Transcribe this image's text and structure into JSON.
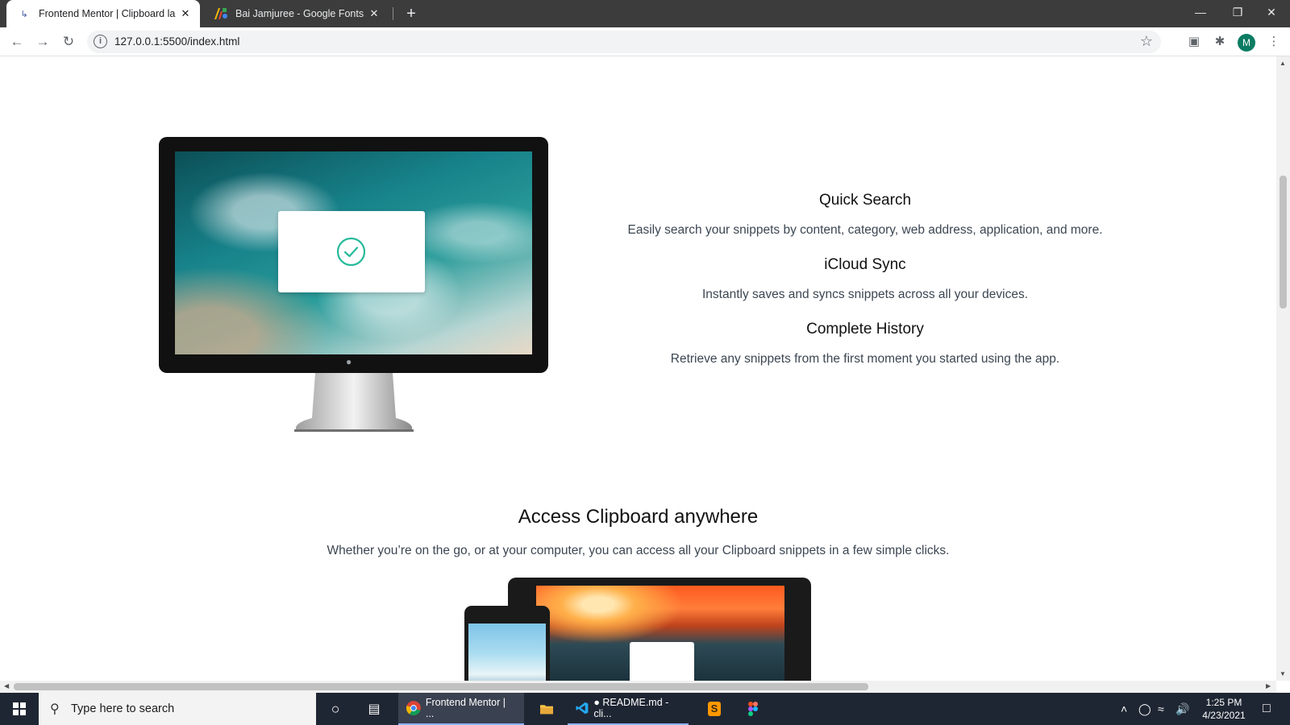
{
  "browser": {
    "tabs": [
      {
        "title": "Frontend Mentor | Clipboard lan",
        "active": true
      },
      {
        "title": "Bai Jamjuree - Google Fonts",
        "active": false
      }
    ],
    "url": "127.0.0.1:5500/index.html",
    "profile_initial": "M"
  },
  "page": {
    "features": [
      {
        "title": "Quick Search",
        "desc": "Easily search your snippets by content, category, web address, application, and more."
      },
      {
        "title": "iCloud Sync",
        "desc": "Instantly saves and syncs snippets across all your devices."
      },
      {
        "title": "Complete History",
        "desc": "Retrieve any snippets from the first moment you started using the app."
      }
    ],
    "access": {
      "title": "Access Clipboard anywhere",
      "desc": "Whether you’re on the go, or at your computer, you can access all your Clipboard snippets in a few simple clicks."
    },
    "accent_color": "#26ba9b"
  },
  "taskbar": {
    "search_placeholder": "Type here to search",
    "apps": [
      {
        "label": "Frontend Mentor | ..."
      },
      {
        "label": "● README.md - cli..."
      }
    ],
    "time": "1:25 PM",
    "date": "4/23/2021"
  }
}
